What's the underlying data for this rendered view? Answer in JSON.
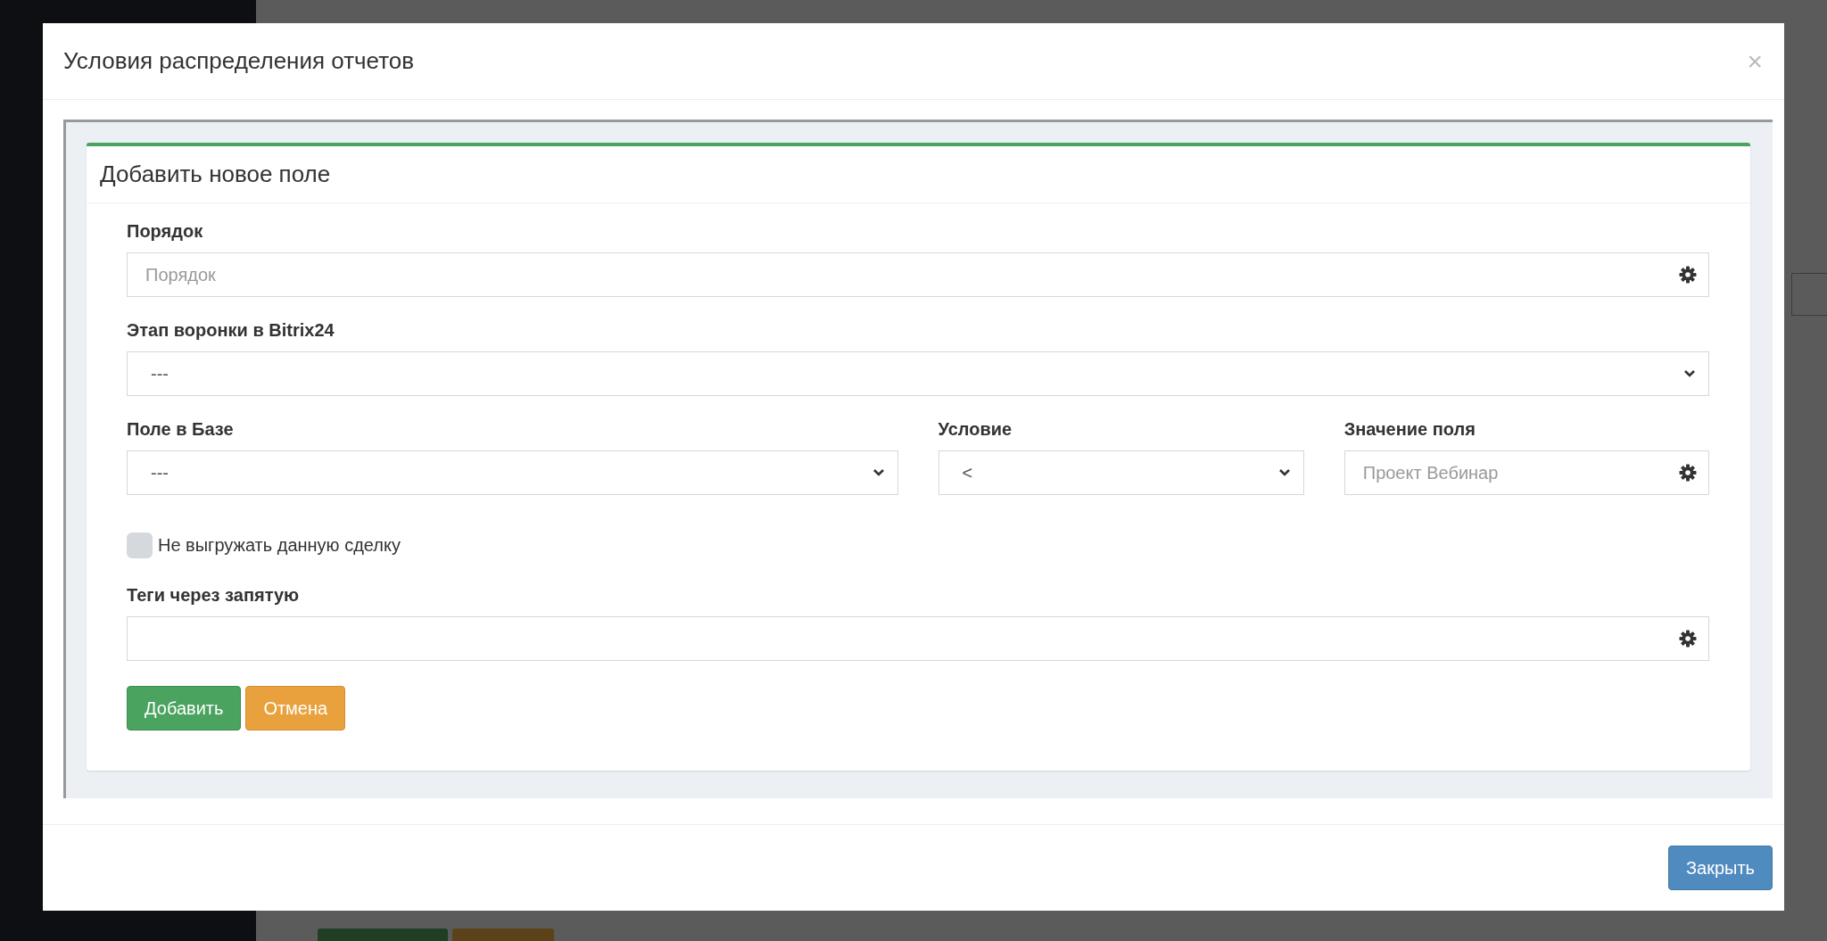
{
  "modal": {
    "title": "Условия распределения отчетов",
    "close": "×"
  },
  "form": {
    "title": "Добавить новое поле",
    "rows": [
      [
        {
          "kind": "input",
          "label": "Порядок",
          "placeholder": "Порядок",
          "gear": true
        }
      ],
      [
        {
          "kind": "select",
          "label": "Этап воронки в Bitrix24",
          "value": "---"
        }
      ],
      [
        {
          "kind": "select",
          "label": "Поле в Базе",
          "value": "---"
        },
        {
          "kind": "select",
          "label": "Условие",
          "value": "<"
        },
        {
          "kind": "input",
          "label": "Значение поля",
          "placeholder": "Проект Вебинар",
          "gear": true
        }
      ],
      [
        {
          "kind": "checkbox",
          "label": "Не выгружать данную сделку",
          "checked": false
        }
      ],
      [
        {
          "kind": "input",
          "label": "Теги через запятую",
          "gear": true
        }
      ]
    ],
    "buttons": [
      {
        "label": "Добавить",
        "kind": "success"
      },
      {
        "label": "Отмена",
        "kind": "warning"
      }
    ]
  },
  "footer_buttons": [
    {
      "label": "Закрыть",
      "kind": "primary"
    }
  ]
}
